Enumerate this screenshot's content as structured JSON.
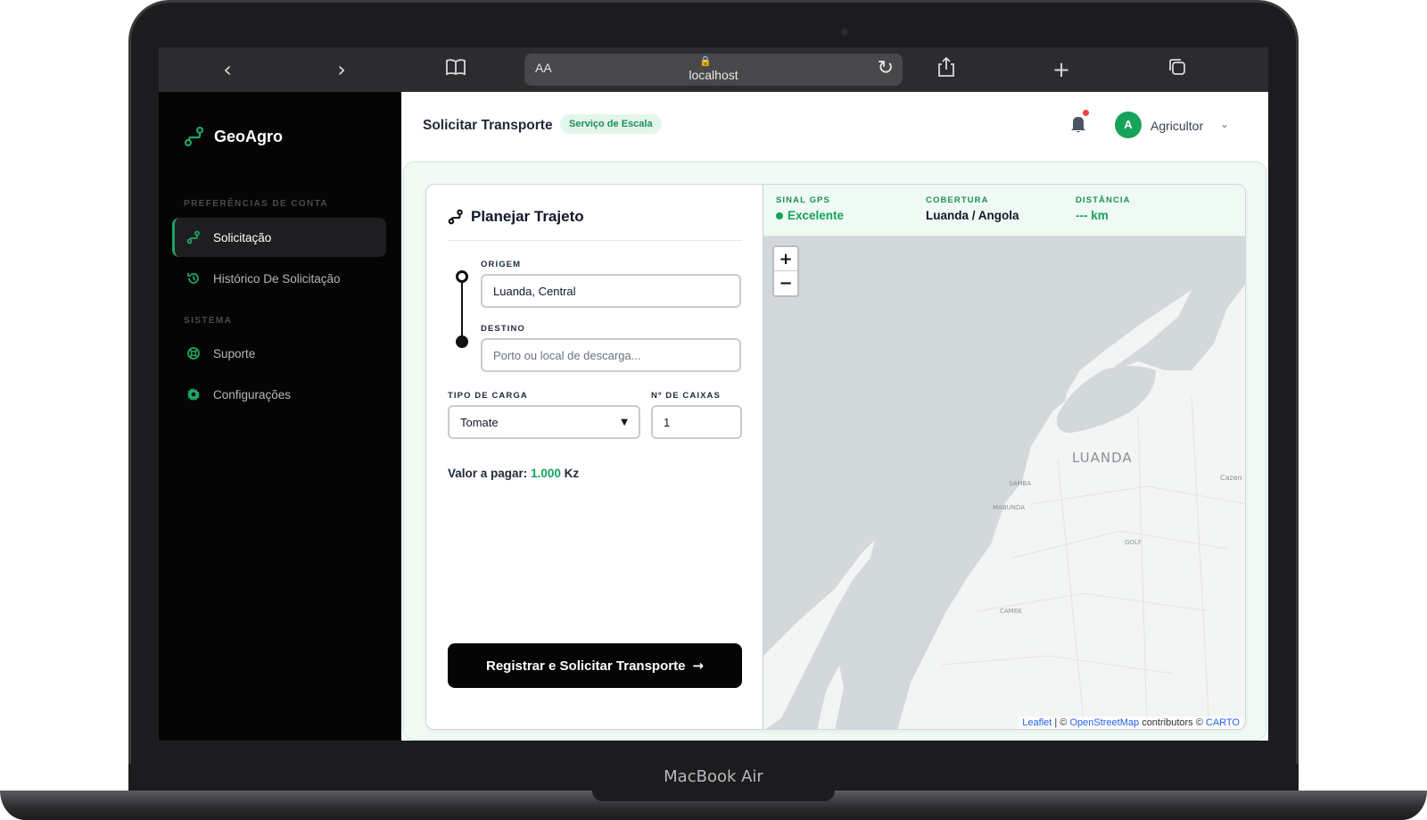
{
  "device": {
    "brand_label": "MacBook Air"
  },
  "browser": {
    "url": "localhost",
    "text_size_label": "AA"
  },
  "sidebar": {
    "app_name": "GeoAgro",
    "sections": [
      {
        "label": "PREFERÊNCIAS DE CONTA"
      },
      {
        "label": "SISTEMA"
      }
    ],
    "items": [
      {
        "label": "Solicitação",
        "icon": "route-icon",
        "active": true
      },
      {
        "label": "Histórico De Solicitação",
        "icon": "history-icon",
        "active": false
      },
      {
        "label": "Suporte",
        "icon": "lifebuoy-icon",
        "active": false
      },
      {
        "label": "Configurações",
        "icon": "gear-icon",
        "active": false
      }
    ]
  },
  "header": {
    "title": "Solicitar Transporte",
    "badge": "Serviço de Escala",
    "user": {
      "initial": "A",
      "name": "Agricultor"
    }
  },
  "form": {
    "title": "Planejar Trajeto",
    "origin": {
      "label": "ORIGEM",
      "value": "Luanda, Central"
    },
    "destination": {
      "label": "DESTINO",
      "placeholder": "Porto ou local de descarga..."
    },
    "cargo": {
      "label": "TIPO DE CARGA",
      "selected": "Tomate"
    },
    "boxes": {
      "label": "Nº DE CAIXAS",
      "value": "1"
    },
    "price": {
      "label": "Valor a pagar:",
      "value": "1.000",
      "currency": "Kz"
    },
    "submit_label": "Registrar e Solicitar Transporte"
  },
  "map": {
    "stats": [
      {
        "label": "SINAL GPS",
        "value": "Excelente"
      },
      {
        "label": "COBERTURA",
        "value": "Luanda / Angola"
      },
      {
        "label": "DISTÂNCIA",
        "value": "--- km"
      }
    ],
    "zoom_in": "+",
    "zoom_out": "−",
    "city_label": "LUANDA",
    "district_labels": [
      "SAMBA",
      "MABUNDA",
      "GOLF",
      "CAMEK",
      "Cazen"
    ],
    "attribution": {
      "leaflet": "Leaflet",
      "sep": "| ©",
      "osm": "OpenStreetMap",
      "contrib": "contributors ©",
      "carto": "CARTO"
    }
  },
  "colors": {
    "accent": "#16a35a",
    "sidebar_bg": "#050505",
    "badge_bg": "#e3f6ec"
  }
}
